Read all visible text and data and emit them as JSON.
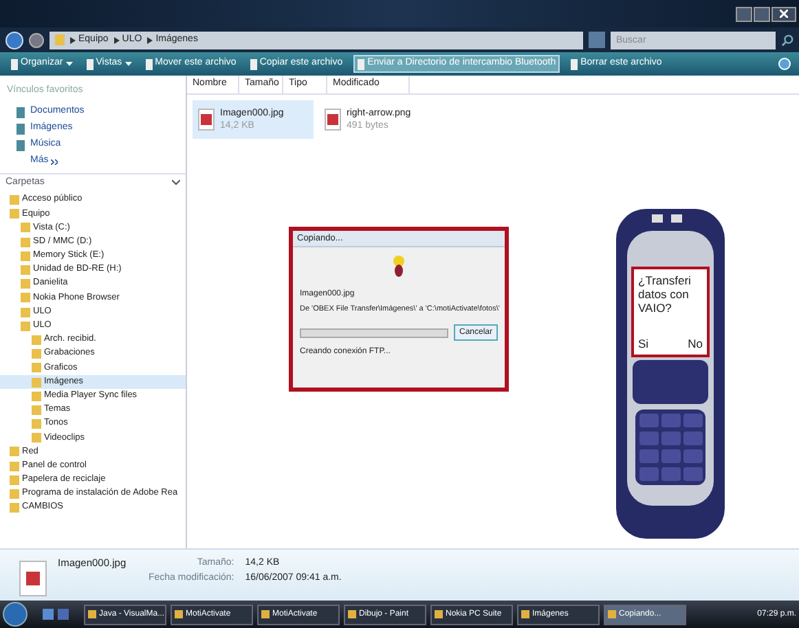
{
  "address_bar": {
    "path": [
      "Equipo",
      "ULO",
      "Imágenes"
    ],
    "search_placeholder": "Buscar"
  },
  "toolbar": {
    "items": [
      {
        "label": "Organizar",
        "dropdown": true,
        "highlighted": false
      },
      {
        "label": "Vistas",
        "dropdown": true,
        "highlighted": false
      },
      {
        "label": "Mover este archivo",
        "dropdown": false,
        "highlighted": false
      },
      {
        "label": "Copiar este archivo",
        "dropdown": false,
        "highlighted": false
      },
      {
        "label": "Enviar a Directorio de intercambio Bluetooth",
        "dropdown": false,
        "highlighted": true
      },
      {
        "label": "Borrar este archivo",
        "dropdown": false,
        "highlighted": false
      }
    ]
  },
  "favorites": {
    "title": "Vínculos favoritos",
    "items": [
      "Documentos",
      "Imágenes",
      "Música"
    ],
    "more": "Más"
  },
  "folders": {
    "title": "Carpetas",
    "tree": [
      {
        "label": "Acceso público",
        "selected": false
      },
      {
        "label": "Equipo",
        "selected": false,
        "children": [
          {
            "label": "Vista (C:)",
            "selected": false
          },
          {
            "label": "SD / MMC (D:)",
            "selected": false
          },
          {
            "label": "Memory Stick (E:)",
            "selected": false
          },
          {
            "label": "Unidad de BD-RE (H:)",
            "selected": false
          },
          {
            "label": "Danielita",
            "selected": false
          },
          {
            "label": "Nokia Phone Browser",
            "selected": false
          },
          {
            "label": "ULO",
            "selected": false
          },
          {
            "label": "ULO",
            "selected": false,
            "children": [
              {
                "label": "Arch. recibid.",
                "selected": false
              },
              {
                "label": "Grabaciones",
                "selected": false
              },
              {
                "label": "Graficos",
                "selected": false
              },
              {
                "label": "Imágenes",
                "selected": true
              },
              {
                "label": "Media Player Sync files",
                "selected": false
              },
              {
                "label": "Temas",
                "selected": false
              },
              {
                "label": "Tonos",
                "selected": false
              },
              {
                "label": "Videoclips",
                "selected": false
              }
            ]
          }
        ]
      },
      {
        "label": "Red",
        "selected": false
      },
      {
        "label": "Panel de control",
        "selected": false
      },
      {
        "label": "Papelera de reciclaje",
        "selected": false
      },
      {
        "label": "Programa de instalación de Adobe Rea",
        "selected": false
      },
      {
        "label": "CAMBIOS",
        "selected": false
      }
    ]
  },
  "file_list": {
    "columns": [
      "Nombre",
      "Tamaño",
      "Tipo",
      "Modificado"
    ],
    "files": [
      {
        "name": "Imagen000.jpg",
        "size": "14,2 KB",
        "selected": true
      },
      {
        "name": "right-arrow.png",
        "size": "491 bytes",
        "selected": false
      }
    ]
  },
  "copy_dialog": {
    "title": "Copiando...",
    "file": "Imagen000.jpg",
    "route": "De 'OBEX File Transfer\\Imágenes\\' a 'C:\\motiActivate\\fotos\\'",
    "level": 0,
    "status": "Creando conexión FTP...",
    "cancel": "Cancelar"
  },
  "phone": {
    "question": "¿Transferi datos con VAIO?",
    "left_softkey": "Si",
    "right_softkey": "No"
  },
  "details_pane": {
    "name": "Imagen000.jpg",
    "size_label": "Tamaño:",
    "size": "14,2 KB",
    "date_label": "Fecha modificación:",
    "date": "16/06/2007 09:41 a.m."
  },
  "taskbar": {
    "items": [
      {
        "label": "Java - VisualMa...",
        "active": false
      },
      {
        "label": "MotiActivate",
        "active": false
      },
      {
        "label": "MotiActivate",
        "active": false
      },
      {
        "label": "Dibujo - Paint",
        "active": false
      },
      {
        "label": "Nokia PC Suite",
        "active": false
      },
      {
        "label": "Imágenes",
        "active": false
      },
      {
        "label": "Copiando...",
        "active": true
      }
    ],
    "clock": "07:29 p.m."
  }
}
